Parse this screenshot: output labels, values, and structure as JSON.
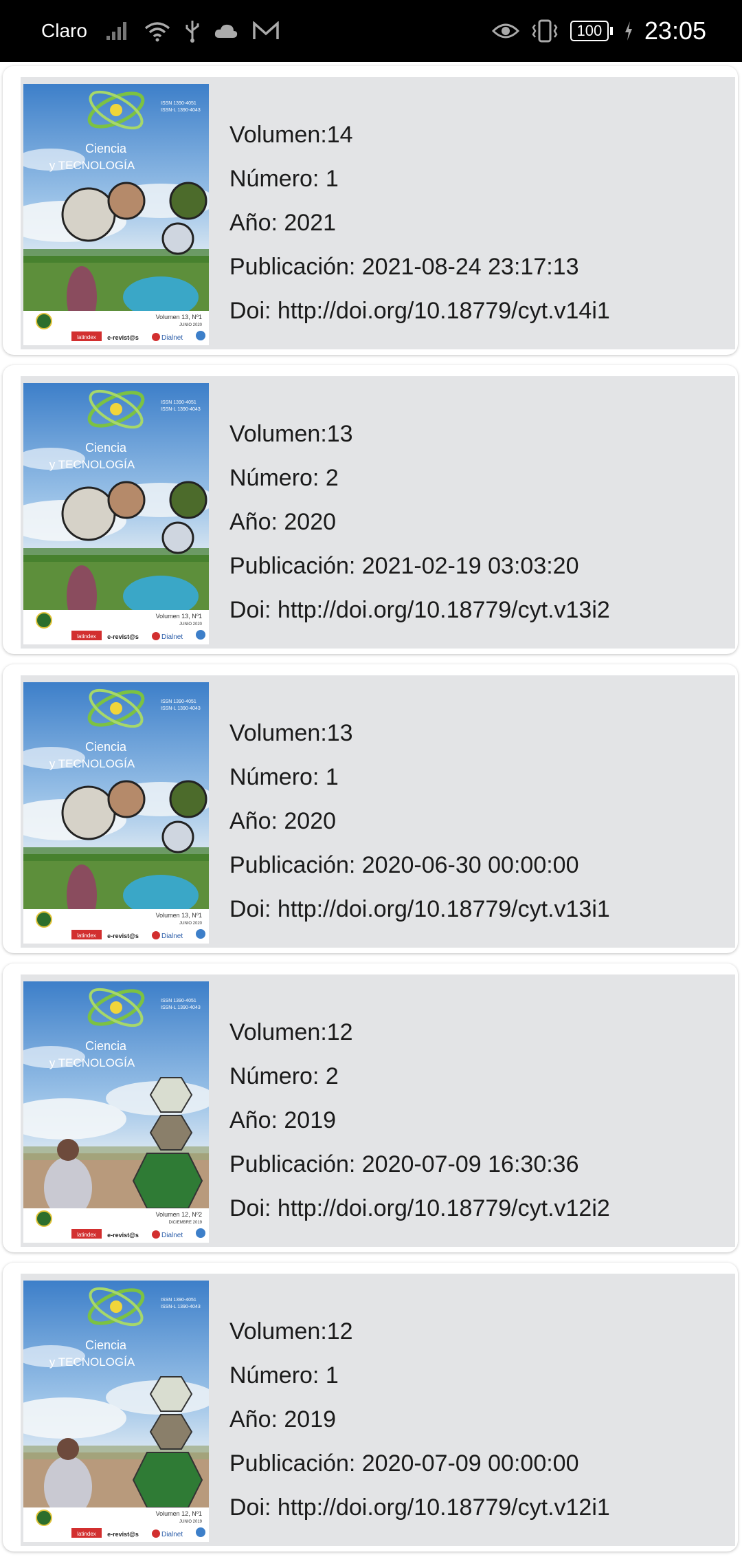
{
  "status_bar": {
    "carrier": "Claro",
    "battery": "100",
    "time": "23:05"
  },
  "issues": [
    {
      "volumen": "Volumen:14",
      "numero": "Número: 1",
      "anio": "Año: 2021",
      "publicacion": "Publicación: 2021-08-24 23:17:13",
      "doi": "Doi: http://doi.org/10.18779/cyt.v14i1",
      "cover": {
        "title_line1": "Ciencia",
        "title_line2": "y TECNOLOGÍA",
        "issn": "ISSN 1390-4051",
        "issn_e": "ISSN-L 1390-4043",
        "vol_text": "Volumen 13, Nº1",
        "date_text": "JUNIO 2020",
        "style": "circles"
      }
    },
    {
      "volumen": "Volumen:13",
      "numero": "Número: 2",
      "anio": "Año: 2020",
      "publicacion": "Publicación: 2021-02-19 03:03:20",
      "doi": "Doi: http://doi.org/10.18779/cyt.v13i2",
      "cover": {
        "title_line1": "Ciencia",
        "title_line2": "y TECNOLOGÍA",
        "issn": "ISSN 1390-4051",
        "issn_e": "ISSN-L 1390-4043",
        "vol_text": "Volumen 13, Nº1",
        "date_text": "JUNIO 2020",
        "style": "circles"
      }
    },
    {
      "volumen": "Volumen:13",
      "numero": "Número: 1",
      "anio": "Año: 2020",
      "publicacion": "Publicación: 2020-06-30 00:00:00",
      "doi": "Doi: http://doi.org/10.18779/cyt.v13i1",
      "cover": {
        "title_line1": "Ciencia",
        "title_line2": "y TECNOLOGÍA",
        "issn": "ISSN 1390-4051",
        "issn_e": "ISSN-L 1390-4043",
        "vol_text": "Volumen 13, Nº1",
        "date_text": "JUNIO 2020",
        "style": "circles"
      }
    },
    {
      "volumen": "Volumen:12",
      "numero": "Número: 2",
      "anio": "Año: 2019",
      "publicacion": "Publicación: 2020-07-09 16:30:36",
      "doi": "Doi: http://doi.org/10.18779/cyt.v12i2",
      "cover": {
        "title_line1": "Ciencia",
        "title_line2": "y TECNOLOGÍA",
        "issn": "ISSN 1390-4051",
        "issn_e": "ISSN-L 1390-4043",
        "vol_text": "Volumen 12, Nº2",
        "date_text": "DICIEMBRE 2019",
        "style": "hexagons"
      }
    },
    {
      "volumen": "Volumen:12",
      "numero": "Número: 1",
      "anio": "Año: 2019",
      "publicacion": "Publicación: 2020-07-09 00:00:00",
      "doi": "Doi: http://doi.org/10.18779/cyt.v12i1",
      "cover": {
        "title_line1": "Ciencia",
        "title_line2": "y TECNOLOGÍA",
        "issn": "ISSN 1390-4051",
        "issn_e": "ISSN-L 1390-4043",
        "vol_text": "Volumen 12, Nº1",
        "date_text": "JUNIO 2019",
        "style": "hexagons"
      }
    }
  ],
  "cover_footer": {
    "latindex": "latindex",
    "erevistas": "e-revist@s",
    "dialnet": "Dialnet"
  }
}
